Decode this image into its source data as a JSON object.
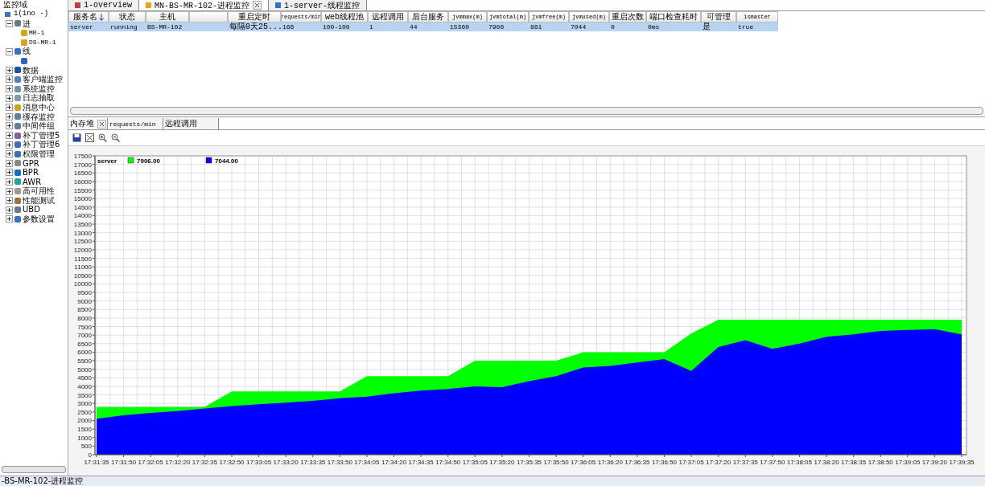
{
  "sidebar": {
    "title": "监控域",
    "tree": [
      {
        "label": "1(1no -)",
        "children": [
          {
            "label": "进",
            "expanded": true,
            "children": [
              {
                "label": "MR-1"
              },
              {
                "label": "DS-MR-1"
              }
            ]
          },
          {
            "label": "线",
            "expanded": true,
            "children": [
              {
                "kind": "chart"
              }
            ]
          },
          {
            "label": "数据",
            "expanded": false
          },
          {
            "label": "客户端监控",
            "expanded": false
          },
          {
            "label": "系统监控",
            "expanded": false
          },
          {
            "label": "日志抽取",
            "expanded": false
          },
          {
            "label": "消息中心",
            "expanded": false
          },
          {
            "label": "缓存监控",
            "expanded": false
          },
          {
            "label": "中间件组",
            "expanded": false
          },
          {
            "label": "补丁管理5",
            "expanded": false
          },
          {
            "label": "补丁管理6",
            "expanded": false
          },
          {
            "label": "权限管理",
            "expanded": false
          },
          {
            "label": "GPR",
            "expanded": false
          },
          {
            "label": "BPR",
            "expanded": false
          },
          {
            "label": "AWR",
            "expanded": false
          },
          {
            "label": "高可用性",
            "expanded": false
          },
          {
            "label": "性能测试",
            "expanded": false
          },
          {
            "label": "UBD",
            "expanded": false
          },
          {
            "label": "参数设置",
            "expanded": false
          }
        ]
      }
    ]
  },
  "top_tabs": [
    {
      "label": "1-overview",
      "selected": false,
      "closable": false
    },
    {
      "label": "MN-BS-MR-102-进程监控",
      "selected": true,
      "closable": true
    },
    {
      "label": "1-server-线程监控",
      "selected": false,
      "closable": false
    }
  ],
  "table": {
    "columns": [
      {
        "label": "服务名",
        "sorted": true
      },
      {
        "label": "状态"
      },
      {
        "label": "主机"
      },
      {},
      {
        "label": "重启定时"
      },
      {
        "label": "requests/min"
      },
      {
        "label": "web线程池"
      },
      {
        "label": "远程调用"
      },
      {
        "label": "后台服务"
      },
      {
        "label": "jvmmax(m)"
      },
      {
        "label": "jvmtotal(m)"
      },
      {
        "label": "jvmfree(m)"
      },
      {
        "label": "jvmused(m)"
      },
      {
        "label": "重启次数"
      },
      {
        "label": "端口检查耗时"
      },
      {
        "label": "可管理"
      },
      {
        "label": "ismaster"
      }
    ],
    "rows": [
      {
        "selected": true,
        "cells": [
          {
            "text": "server"
          },
          {
            "text": "running"
          },
          {
            "text": "BS-MR-102"
          },
          {},
          {
            "text": "每隔0天25..."
          },
          {
            "text": "166"
          },
          {
            "text": "100-100"
          },
          {
            "text": "1"
          },
          {
            "text": "44"
          },
          {
            "text": "15360"
          },
          {
            "text": "7906"
          },
          {
            "text": "861"
          },
          {
            "text": "7044"
          },
          {
            "text": "0"
          },
          {
            "text": "0ms"
          },
          {
            "text": "是"
          },
          {
            "text": "true"
          }
        ]
      }
    ]
  },
  "bottom_tabs": [
    {
      "label": "内存堆",
      "selected": true,
      "closable": true
    },
    {
      "label": "requests/min",
      "selected": false,
      "closable": false
    },
    {
      "label": "远程调用",
      "selected": false,
      "closable": false
    }
  ],
  "chart_data": {
    "type": "area",
    "title": "server",
    "grid": true,
    "legend": "top-left",
    "x": [
      "17:31:35",
      "17:31:50",
      "17:32:05",
      "17:32:20",
      "17:32:35",
      "17:32:50",
      "17:33:05",
      "17:33:20",
      "17:33:35",
      "17:33:50",
      "17:34:05",
      "17:34:20",
      "17:34:35",
      "17:34:50",
      "17:35:05",
      "17:35:20",
      "17:35:35",
      "17:35:50",
      "17:36:05",
      "17:36:20",
      "17:36:35",
      "17:36:50",
      "17:37:05",
      "17:37:20",
      "17:37:35",
      "17:37:50",
      "17:38:05",
      "17:38:20",
      "17:38:35",
      "17:38:50",
      "17:39:05",
      "17:39:20",
      "17:39:35"
    ],
    "series": [
      {
        "name": "7906.00",
        "color": "#00ff00",
        "values": [
          2800,
          2800,
          2800,
          2800,
          2800,
          3700,
          3700,
          3700,
          3700,
          3700,
          4600,
          4600,
          4600,
          4600,
          5500,
          5500,
          5500,
          5500,
          6000,
          6000,
          6000,
          6000,
          7100,
          7900,
          7900,
          7900,
          7900,
          7900,
          7900,
          7900,
          7900,
          7900,
          7900
        ]
      },
      {
        "name": "7044.00",
        "color": "#0000ff",
        "values": [
          2100,
          2300,
          2450,
          2550,
          2700,
          2850,
          2950,
          3050,
          3150,
          3300,
          3400,
          3600,
          3750,
          3850,
          4000,
          3950,
          4300,
          4600,
          5100,
          5200,
          5400,
          5600,
          4900,
          6300,
          6700,
          6200,
          6500,
          6900,
          7050,
          7250,
          7300,
          7350,
          7050
        ]
      }
    ],
    "ylim": [
      0,
      17500
    ],
    "yticks": [
      0,
      500,
      1000,
      1500,
      2000,
      2500,
      3000,
      3500,
      4000,
      4500,
      5000,
      5500,
      6000,
      6500,
      7000,
      7500,
      8000,
      8500,
      9000,
      9500,
      10000,
      10500,
      11000,
      11500,
      12000,
      12500,
      13000,
      13500,
      14000,
      14500,
      15000,
      15500,
      16000,
      16500,
      17000,
      17500
    ]
  },
  "status_bar": {
    "text": "-BS-MR-102-进程监控"
  }
}
